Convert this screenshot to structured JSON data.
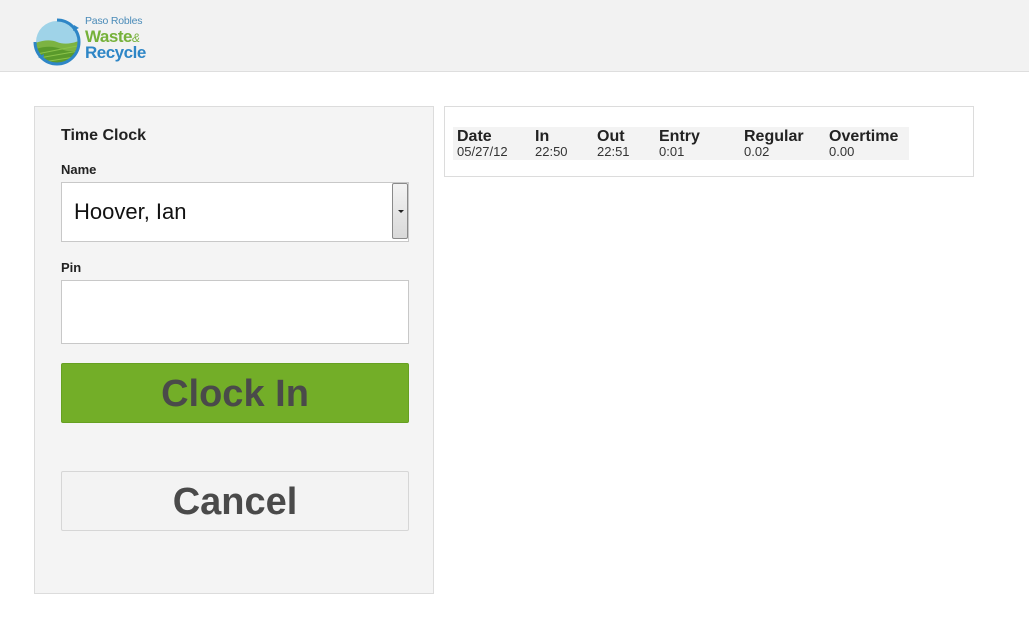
{
  "logo": {
    "line1": "Paso Robles",
    "line2": "Waste",
    "amp": "&",
    "line3": "Recycle"
  },
  "time_clock": {
    "title": "Time Clock",
    "name_label": "Name",
    "name_value": "Hoover, Ian",
    "pin_label": "Pin",
    "pin_value": "",
    "clock_in_label": "Clock In",
    "cancel_label": "Cancel"
  },
  "entries": {
    "columns": [
      "Date",
      "In",
      "Out",
      "Entry",
      "Regular",
      "Overtime"
    ],
    "rows": [
      [
        "05/27/12",
        "22:50",
        "22:51",
        "0:01",
        "0.02",
        "0.00"
      ]
    ]
  },
  "colors": {
    "clock_in_bg": "#73ae28",
    "cancel_bg": "#f3f3f3",
    "header_bg": "#f2f2f2"
  }
}
